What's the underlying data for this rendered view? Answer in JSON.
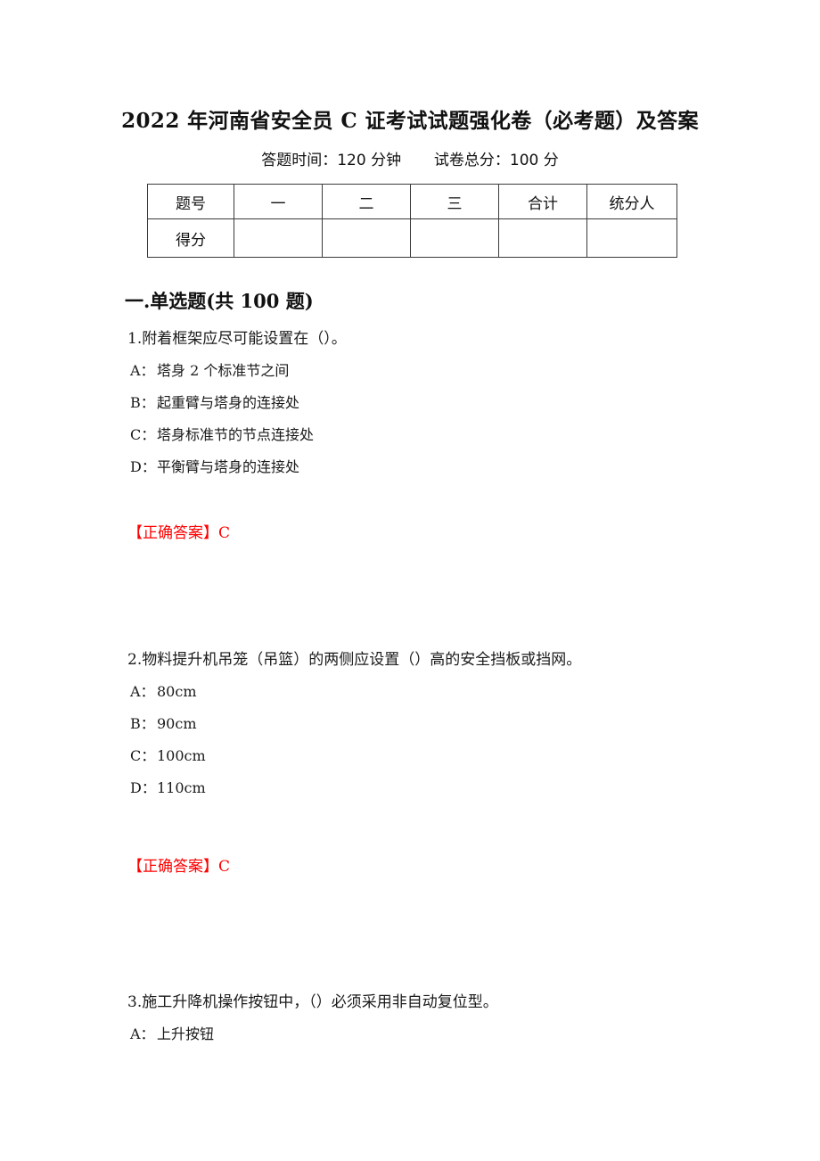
{
  "document": {
    "title": "2022 年河南省安全员 C 证考试试题强化卷（必考题）及答案",
    "subtitle_time": "答题时间：120 分钟",
    "subtitle_total": "试卷总分：100 分",
    "answer_color": "#ff0000"
  },
  "score_table": {
    "row_labels": [
      "题号",
      "得分"
    ],
    "columns": [
      "一",
      "二",
      "三",
      "合计",
      "统分人"
    ],
    "header": [
      "题号",
      "一",
      "二",
      "三",
      "合计",
      "统分人"
    ],
    "body": [
      "得分",
      "",
      "",
      "",
      "",
      ""
    ]
  },
  "section": {
    "heading": "一.单选题(共 100 题)"
  },
  "questions": [
    {
      "stem": "1.附着框架应尽可能设置在（）。",
      "options": [
        {
          "key": "A：",
          "text": "塔身 2 个标准节之间"
        },
        {
          "key": "B：",
          "text": "起重臂与塔身的连接处"
        },
        {
          "key": "C：",
          "text": "塔身标准节的节点连接处"
        },
        {
          "key": "D：",
          "text": "平衡臂与塔身的连接处"
        }
      ],
      "answer_label": "【正确答案】",
      "answer_value": "C"
    },
    {
      "stem": "2.物料提升机吊笼（吊篮）的两侧应设置（）高的安全挡板或挡网。",
      "options": [
        {
          "key": "A：",
          "text": "80cm"
        },
        {
          "key": "B：",
          "text": "90cm"
        },
        {
          "key": "C：",
          "text": "100cm"
        },
        {
          "key": "D：",
          "text": "110cm"
        }
      ],
      "answer_label": "【正确答案】",
      "answer_value": "C"
    },
    {
      "stem": "3.施工升降机操作按钮中，（）必须采用非自动复位型。",
      "options": [
        {
          "key": "A：",
          "text": "上升按钮"
        }
      ],
      "answer_label": "",
      "answer_value": ""
    }
  ]
}
